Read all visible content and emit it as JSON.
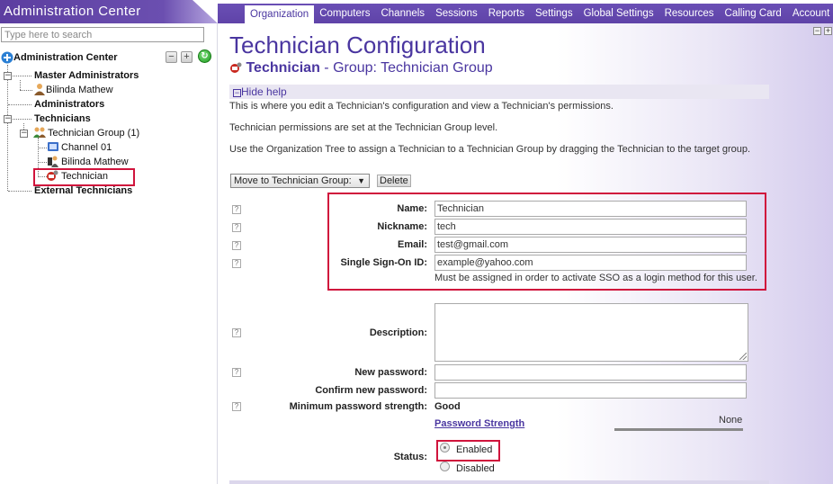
{
  "app": {
    "title": "Administration Center"
  },
  "tabs": [
    {
      "label": "Organization",
      "active": true
    },
    {
      "label": "Computers"
    },
    {
      "label": "Channels"
    },
    {
      "label": "Sessions"
    },
    {
      "label": "Reports"
    },
    {
      "label": "Settings"
    },
    {
      "label": "Global Settings"
    },
    {
      "label": "Resources"
    },
    {
      "label": "Calling Card"
    },
    {
      "label": "Account"
    }
  ],
  "sidebar": {
    "search_placeholder": "Type here to search",
    "root_label": "Administration Center",
    "tree": {
      "master_admins": "Master Administrators",
      "bilinda_admin": "Bilinda Mathew",
      "administrators": "Administrators",
      "technicians": "Technicians",
      "tech_group": "Technician Group (1)",
      "channel": "Channel 01",
      "bilinda_tech": "Bilinda Mathew",
      "technician": "Technician",
      "external": "External Technicians"
    }
  },
  "main": {
    "title": "Technician Configuration",
    "subtitle_name": "Technician",
    "subtitle_group": " - Group: Technician Group",
    "hide_help": "Hide help",
    "help_lines": [
      "This is where you edit a Technician's configuration and view a Technician's permissions.",
      "Technician permissions are set at the Technician Group level.",
      "Use the Organization Tree to assign a Technician to a Technician Group by dragging the Technician to the target group."
    ],
    "move_select": "Move to Technician Group:",
    "delete_label": "Delete",
    "fields": {
      "name_label": "Name:",
      "name_value": "Technician",
      "nickname_label": "Nickname:",
      "nickname_value": "tech",
      "email_label": "Email:",
      "email_value": "test@gmail.com",
      "sso_label": "Single Sign-On ID:",
      "sso_value": "example@yahoo.com",
      "sso_note": "Must be assigned in order to activate SSO as a login method for this user.",
      "description_label": "Description:",
      "new_password_label": "New password:",
      "confirm_password_label": "Confirm new password:",
      "min_strength_label": "Minimum password strength:",
      "min_strength_value": "Good",
      "strength_link": "Password Strength",
      "strength_meter_value": "None",
      "status_label": "Status:",
      "status_enabled": "Enabled",
      "status_disabled": "Disabled",
      "status_selected": "Enabled"
    }
  },
  "colors": {
    "accent": "#5c3ea0",
    "highlight": "#d0143c",
    "title": "#4a36a0"
  },
  "icons": [
    "collapse-icon",
    "expand-icon",
    "refresh-icon",
    "user-icon",
    "group-icon",
    "channel-icon",
    "technician-icon",
    "help-icon",
    "dropdown-arrow-icon"
  ]
}
